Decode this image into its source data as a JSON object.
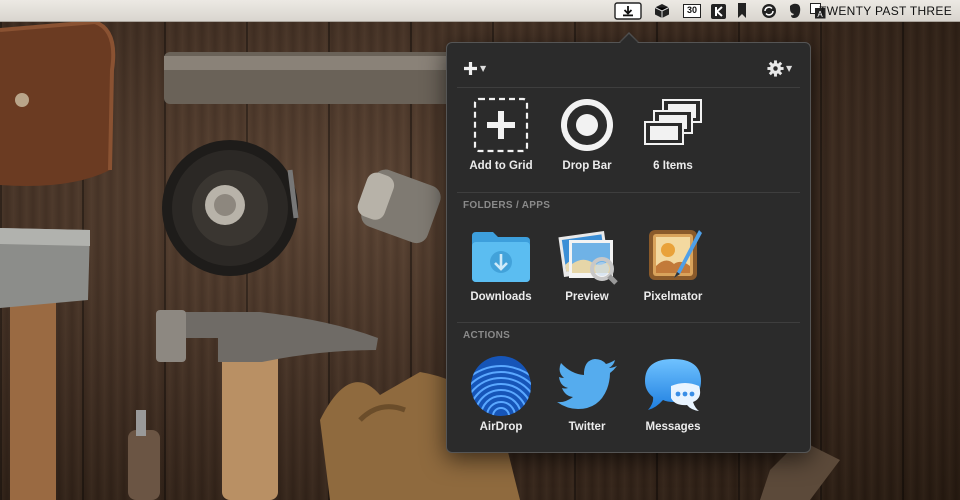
{
  "menubar": {
    "clock": "TWENTY PAST THREE",
    "calendar_day": "30",
    "status_icons": [
      "dropzone-icon",
      "box-icon",
      "calendar-icon",
      "kindle-icon",
      "bookmark-icon",
      "sync-icon",
      "evernote-icon",
      "input-source-icon"
    ]
  },
  "popover": {
    "toolbar": {
      "add_icon": "plus-icon",
      "settings_icon": "gear-icon"
    },
    "top_items": [
      {
        "label": "Add to Grid",
        "icon": "add-to-grid-icon"
      },
      {
        "label": "Drop Bar",
        "icon": "drop-bar-icon"
      },
      {
        "label": "6 Items",
        "icon": "stacked-items-icon"
      }
    ],
    "folders_header": "FOLDERS / APPS",
    "folders": [
      {
        "label": "Downloads",
        "icon": "downloads-folder-icon"
      },
      {
        "label": "Preview",
        "icon": "preview-app-icon"
      },
      {
        "label": "Pixelmator",
        "icon": "pixelmator-app-icon"
      }
    ],
    "actions_header": "ACTIONS",
    "actions": [
      {
        "label": "AirDrop",
        "icon": "airdrop-icon"
      },
      {
        "label": "Twitter",
        "icon": "twitter-icon"
      },
      {
        "label": "Messages",
        "icon": "messages-icon"
      }
    ]
  },
  "colors": {
    "popover_bg": "#2b2b2b",
    "folder_blue": "#4fb3ec",
    "airdrop_blue": "#1b6fd1",
    "twitter_blue": "#55acee",
    "messages_blue": "#3a9cf4",
    "section_header": "#8a8a8a"
  }
}
